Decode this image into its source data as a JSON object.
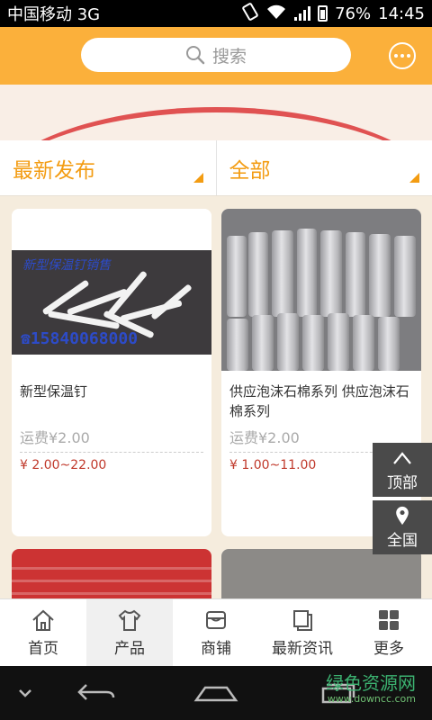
{
  "status_bar": {
    "carrier": "中国移动 3G",
    "network": "3G",
    "battery": "76%",
    "time": "14:45"
  },
  "header": {
    "search_placeholder": "搜索"
  },
  "filters": [
    {
      "label": "最新发布"
    },
    {
      "label": "全部"
    }
  ],
  "products": [
    {
      "image_text": "新型保温钉销售",
      "image_phone": "☎15840068000",
      "title": "新型保温钉",
      "shipping": "运费¥2.00",
      "price": "¥ 2.00~22.00"
    },
    {
      "title": "供应泡沫石棉系列 供应泡沫石棉系列",
      "shipping": "运费¥2.00",
      "price": "¥ 1.00~11.00"
    },
    {
      "title": ""
    },
    {
      "title": ""
    }
  ],
  "floating": {
    "top_label": "顶部",
    "location_label": "全国"
  },
  "bottom_nav": [
    {
      "label": "首页",
      "icon": "home-icon"
    },
    {
      "label": "产品",
      "icon": "shirt-icon"
    },
    {
      "label": "商铺",
      "icon": "shop-icon"
    },
    {
      "label": "最新资讯",
      "icon": "news-icon"
    },
    {
      "label": "更多",
      "icon": "grid-icon"
    }
  ],
  "watermark": {
    "text": "绿色资源网",
    "url": "www.downcc.com"
  },
  "colors": {
    "accent": "#fbb03b",
    "filter_text": "#f39c12",
    "price": "#c0392b"
  }
}
